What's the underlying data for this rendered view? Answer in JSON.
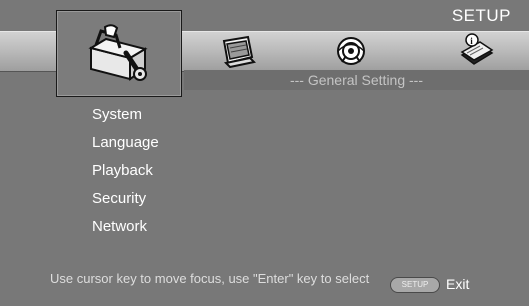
{
  "header": {
    "title": "SETUP"
  },
  "icons": {
    "general": "toolbox-wrench-icon",
    "display": "display-monitor-icon",
    "audio": "speaker-audio-icon",
    "info": "info-book-icon"
  },
  "section": {
    "title": "--- General Setting ---"
  },
  "menu": {
    "items": [
      {
        "label": "System"
      },
      {
        "label": "Language"
      },
      {
        "label": "Playback"
      },
      {
        "label": "Security"
      },
      {
        "label": "Network"
      }
    ]
  },
  "footer": {
    "hint": "Use cursor key to move focus, use \"Enter\" key to select",
    "setup_button": "SETUP",
    "exit_label": "Exit"
  },
  "colors": {
    "background": "#787878",
    "text": "#ffffff"
  }
}
